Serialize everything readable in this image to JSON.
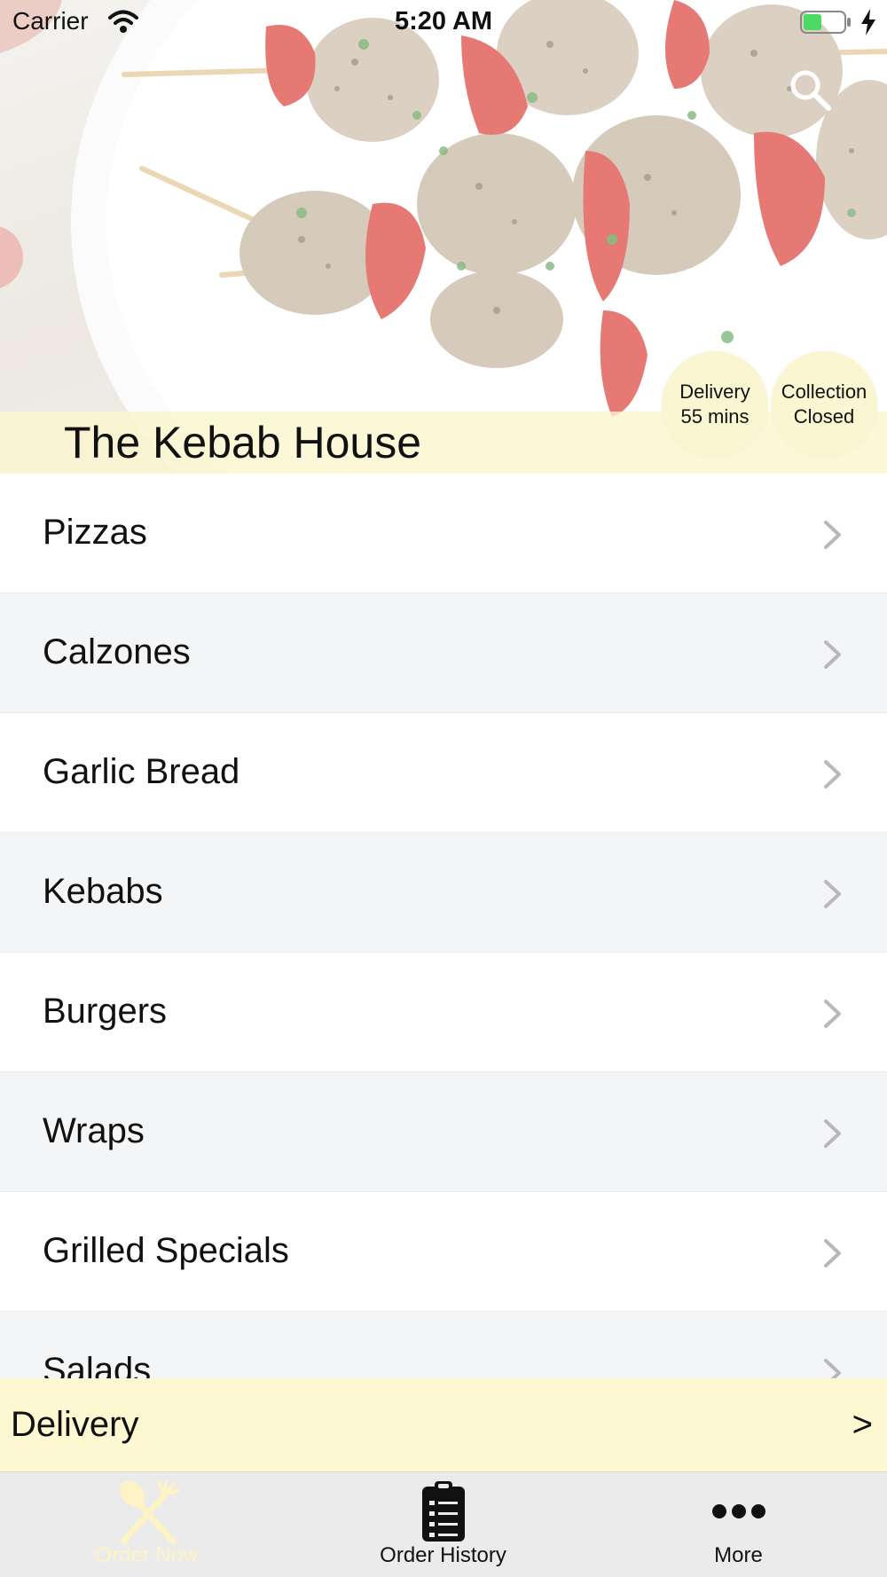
{
  "status_bar": {
    "carrier": "Carrier",
    "time": "5:20 AM",
    "icons": [
      "wifi-icon",
      "battery-icon",
      "charging-icon"
    ]
  },
  "header": {
    "restaurant_name": "The Kebab House",
    "search_icon": "search-icon",
    "badges": {
      "delivery": {
        "line1": "Delivery",
        "line2": "55 mins"
      },
      "collection": {
        "line1": "Collection",
        "line2": "Closed"
      }
    }
  },
  "menu": {
    "items": [
      {
        "label": "Pizzas"
      },
      {
        "label": "Calzones"
      },
      {
        "label": "Garlic Bread"
      },
      {
        "label": "Kebabs"
      },
      {
        "label": "Burgers"
      },
      {
        "label": "Wraps"
      },
      {
        "label": "Grilled Specials"
      },
      {
        "label": "Salads"
      }
    ]
  },
  "delivery_bar": {
    "label": "Delivery",
    "arrow": ">"
  },
  "tab_bar": {
    "tabs": [
      {
        "label": "Order Now",
        "icon": "fork-knife-icon",
        "active": true
      },
      {
        "label": "Order History",
        "icon": "clipboard-icon",
        "active": false
      },
      {
        "label": "More",
        "icon": "more-dots-icon",
        "active": false
      }
    ]
  },
  "colors": {
    "accent_cream": "#fdf8d2",
    "active_tab": "#fdf3c4",
    "row_alt": "#f4f5f7",
    "tab_bar_bg": "#ebebeb"
  }
}
